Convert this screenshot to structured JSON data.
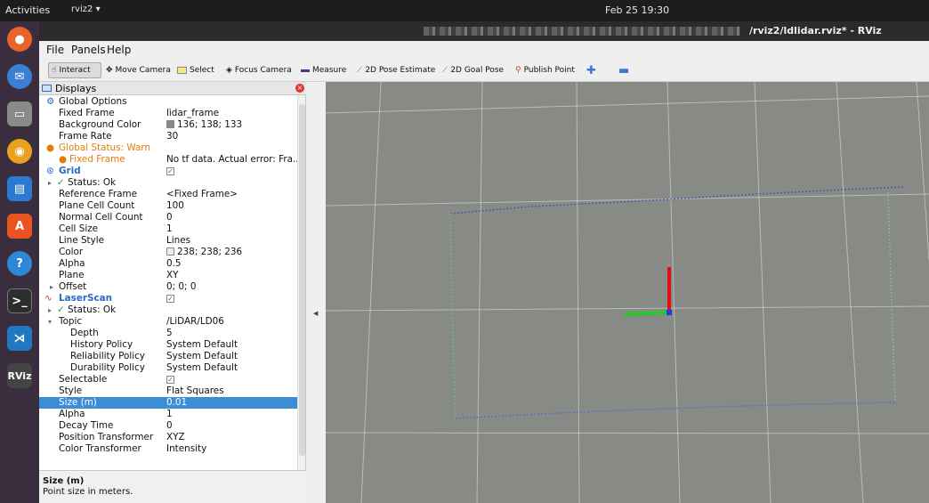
{
  "topbar": {
    "activities": "Activities",
    "app_menu": "rviz2",
    "clock": "Feb 25 19:30"
  },
  "window": {
    "title": "/rviz2/ldlidar.rviz* - RViz"
  },
  "menu": [
    "File",
    "Panels",
    "Help"
  ],
  "toolbar": [
    {
      "label": "Interact",
      "icon": "cursor-hand-icon"
    },
    {
      "label": "Move Camera",
      "icon": "move-camera-icon"
    },
    {
      "label": "Select",
      "icon": "select-box-icon"
    },
    {
      "label": "Focus Camera",
      "icon": "focus-camera-icon"
    },
    {
      "label": "Measure",
      "icon": "ruler-icon"
    },
    {
      "label": "2D Pose Estimate",
      "icon": "green-arrow-icon"
    },
    {
      "label": "2D Goal Pose",
      "icon": "green-arrow-icon"
    },
    {
      "label": "Publish Point",
      "icon": "map-pin-icon"
    }
  ],
  "displays": {
    "title": "Displays",
    "rows": [
      {
        "k": "Global Options",
        "v": ""
      },
      {
        "k": "Fixed Frame",
        "v": "lidar_frame"
      },
      {
        "k": "Background Color",
        "v": "136; 138; 133"
      },
      {
        "k": "Frame Rate",
        "v": "30"
      },
      {
        "k": "Global Status: Warn",
        "v": ""
      },
      {
        "k": "Fixed Frame",
        "v": "No tf data.  Actual error: Fra..."
      },
      {
        "k": "Grid",
        "v": "✓"
      },
      {
        "k": "Status: Ok",
        "v": ""
      },
      {
        "k": "Reference Frame",
        "v": "<Fixed Frame>"
      },
      {
        "k": "Plane Cell Count",
        "v": "100"
      },
      {
        "k": "Normal Cell Count",
        "v": "0"
      },
      {
        "k": "Cell Size",
        "v": "1"
      },
      {
        "k": "Line Style",
        "v": "Lines"
      },
      {
        "k": "Color",
        "v": "238; 238; 236"
      },
      {
        "k": "Alpha",
        "v": "0.5"
      },
      {
        "k": "Plane",
        "v": "XY"
      },
      {
        "k": "Offset",
        "v": "0; 0; 0"
      },
      {
        "k": "LaserScan",
        "v": "✓"
      },
      {
        "k": "Status: Ok",
        "v": ""
      },
      {
        "k": "Topic",
        "v": "/LiDAR/LD06"
      },
      {
        "k": "Depth",
        "v": "5"
      },
      {
        "k": "History Policy",
        "v": "System Default"
      },
      {
        "k": "Reliability Policy",
        "v": "System Default"
      },
      {
        "k": "Durability Policy",
        "v": "System Default"
      },
      {
        "k": "Selectable",
        "v": "✓"
      },
      {
        "k": "Style",
        "v": "Flat Squares"
      },
      {
        "k": "Size (m)",
        "v": "0.01"
      },
      {
        "k": "Alpha",
        "v": "1"
      },
      {
        "k": "Decay Time",
        "v": "0"
      },
      {
        "k": "Position Transformer",
        "v": "XYZ"
      },
      {
        "k": "Color Transformer",
        "v": "Intensity"
      }
    ]
  },
  "help": {
    "title": "Size (m)",
    "desc": "Point size in meters."
  },
  "colors": {
    "viewport_bg": "#888a85",
    "grid": "#eeeeec",
    "selected_row": "#3b8ed6"
  }
}
